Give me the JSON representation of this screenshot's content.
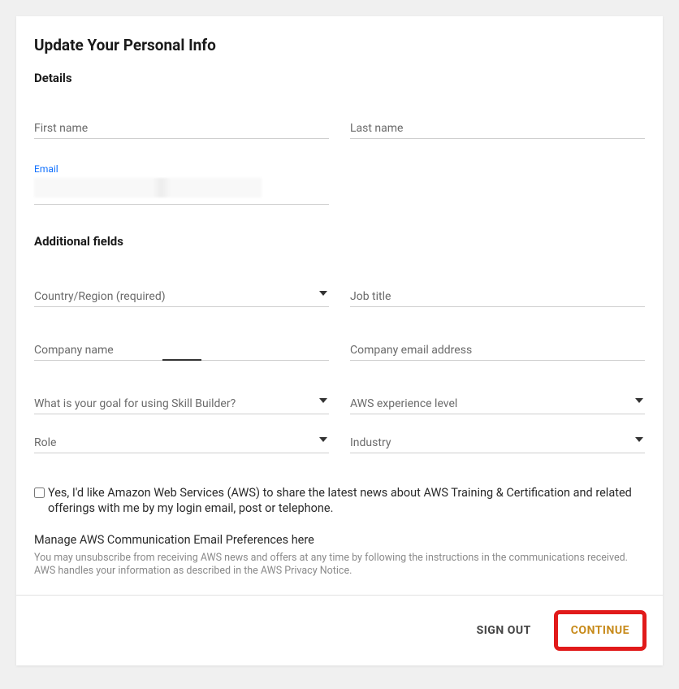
{
  "title": "Update Your Personal Info",
  "details": {
    "heading": "Details",
    "first_name_label": "First name",
    "last_name_label": "Last name",
    "email_label": "Email",
    "email_value": ""
  },
  "additional": {
    "heading": "Additional fields",
    "country_label": "Country/Region (required)",
    "job_title_label": "Job title",
    "company_name_label": "Company name",
    "company_email_label": "Company email address",
    "goal_label": "What is your goal for using Skill Builder?",
    "experience_label": "AWS experience level",
    "role_label": "Role",
    "industry_label": "Industry"
  },
  "consent": {
    "checkbox_label": "Yes, I'd like Amazon Web Services (AWS) to share the latest news about AWS Training & Certification and related offerings with me by my login email, post or telephone.",
    "manage_text": "Manage AWS Communication Email Preferences here",
    "fine_print": "You may unsubscribe from receiving AWS news and offers at any time by following the instructions in the communications received. AWS handles your information as described in the AWS Privacy Notice."
  },
  "footer": {
    "signout": "SIGN OUT",
    "continue": "CONTINUE"
  }
}
